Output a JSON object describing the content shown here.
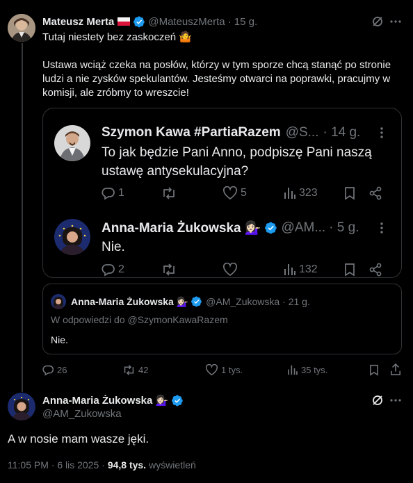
{
  "tweet": {
    "author_name": "Mateusz Merta",
    "handle": "@MateuszMerta",
    "time": "· 15 g.",
    "text_line1": "Tutaj niestety bez zaskoczeń 🤷",
    "text_para2_l1": "Ustawa wciąż czeka na posłów,  którzy w tym sporze chcą stanąć po stronie",
    "text_para2_l2": "ludzi a nie zysków spekulantów. Jesteśmy otwarci na poprawki, pracujmy w",
    "text_para2_l3": "komisji, ale zróbmy to wreszcie!",
    "replies": "26",
    "reposts": "42",
    "likes": "1 tys.",
    "views": "35 tys."
  },
  "screenshot": {
    "post1": {
      "author": "Szymon Kawa #PartiaRazem",
      "handle": "@S...",
      "time": "· 14 g.",
      "text_l1": "To jak będzie Pani Anno, podpiszę Pani naszą",
      "text_l2": "ustawę antysekulacyjna?",
      "replies": "1",
      "likes": "5",
      "views": "323"
    },
    "post2": {
      "author": "Anna-Maria Żukowska 💁🏻‍♀️",
      "handle": "@AM...",
      "time": "· 5 g.",
      "text": "Nie.",
      "replies": "2",
      "views": "132"
    }
  },
  "quoted": {
    "author": "Anna-Maria Żukowska 💁🏻‍♀️",
    "handle": "@AM_Zukowska",
    "time": "· 21 g.",
    "reply_to": "W odpowiedzi do @SzymonKawaRazem",
    "text": "Nie."
  },
  "reply": {
    "author": "Anna-Maria Żukowska 💁🏻‍♀️",
    "handle": "@AM_Zukowska",
    "text": "A w nosie mam wasze jęki.",
    "timestamp": "11:05 PM · 6 lis 2025 ·",
    "views_count": "94,8 tys.",
    "views_label": "wyświetleń"
  },
  "colors": {
    "background": "#000000",
    "text": "#e7e9ea",
    "muted": "#71767b",
    "verified": "#1d9bf0",
    "border": "#2f3336"
  }
}
